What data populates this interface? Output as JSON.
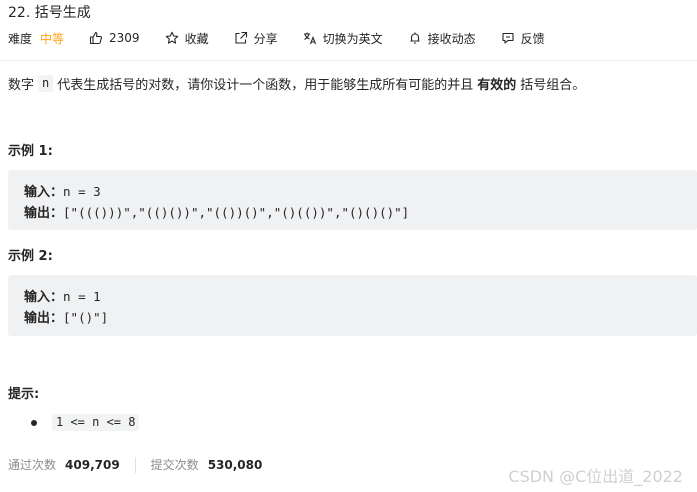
{
  "problem": {
    "title": "22. 括号生成",
    "difficulty_label": "难度",
    "difficulty_value": "中等",
    "likes": "2309",
    "favorite_label": "收藏",
    "share_label": "分享",
    "translate_label": "切换为英文",
    "subscribe_label": "接收动态",
    "feedback_label": "反馈"
  },
  "description": {
    "part1": "数字",
    "code": "n",
    "part2": "代表生成括号的对数，请你设计一个函数，用于能够生成所有可能的并且",
    "bold": "有效的",
    "part3": "括号组合。"
  },
  "examples": [
    {
      "title": "示例 1:",
      "input_label": "输入：",
      "input": "n = 3",
      "output_label": "输出：",
      "output": "[\"((()))\",\"(()())\",\"(())()\",\"()(())\",\"()()()\"]"
    },
    {
      "title": "示例 2:",
      "input_label": "输入：",
      "input": "n = 1",
      "output_label": "输出：",
      "output": "[\"()\"]"
    }
  ],
  "hints": {
    "title": "提示:",
    "items": [
      "1 <= n <= 8"
    ]
  },
  "stats": {
    "accepted_label": "通过次数",
    "accepted_value": "409,709",
    "submissions_label": "提交次数",
    "submissions_value": "530,080"
  },
  "watermark": "CSDN @C位出道_2022",
  "colors": {
    "accent": "#ffa116",
    "code_bg": "#f0f1f3",
    "text": "#262626",
    "muted": "#8c8c8c"
  }
}
